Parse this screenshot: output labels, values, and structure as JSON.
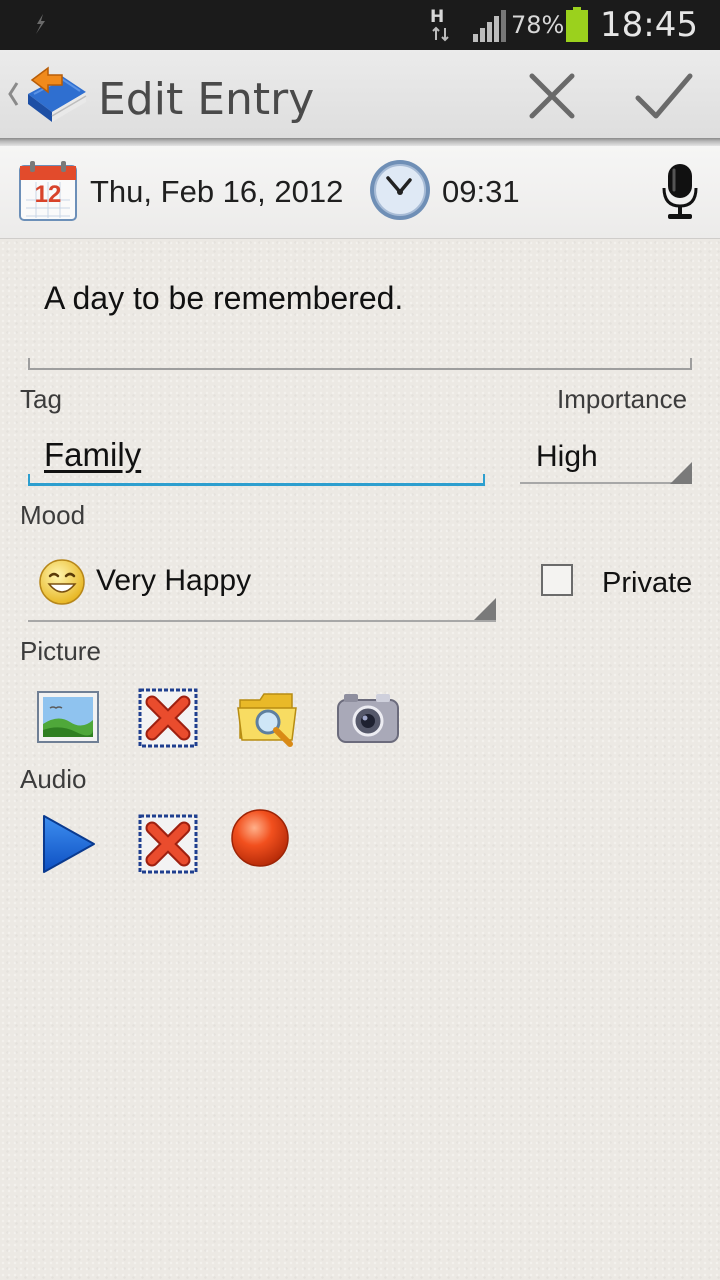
{
  "status_bar": {
    "network_type": "H",
    "battery_percent": "78%",
    "time": "18:45",
    "icons": [
      "usb-icon",
      "data-sync-icon",
      "signal-icon",
      "battery-icon"
    ],
    "battery_color": "#9bd11d"
  },
  "action_bar": {
    "title": "Edit Entry",
    "icons": [
      "up-caret-icon",
      "diary-book-icon",
      "close-icon",
      "checkmark-icon"
    ]
  },
  "date_row": {
    "date": "Thu, Feb 16, 2012",
    "time": "09:31",
    "calendar_day": "12",
    "icons": [
      "calendar-icon",
      "clock-icon",
      "microphone-icon"
    ]
  },
  "entry": {
    "text": "A day to be remembered."
  },
  "fields": {
    "tag_label": "Tag",
    "tag_value": "Family",
    "importance_label": "Importance",
    "importance_value": "High",
    "mood_label": "Mood",
    "mood_value": "Very Happy",
    "private_label": "Private",
    "private_checked": false
  },
  "picture": {
    "label": "Picture",
    "buttons": [
      "view-picture-icon",
      "delete-picture-icon",
      "browse-folder-icon",
      "camera-icon"
    ]
  },
  "audio": {
    "label": "Audio",
    "buttons": [
      "play-icon",
      "delete-audio-icon",
      "record-icon"
    ]
  },
  "colors": {
    "accent": "#2e9fcf",
    "status_bar_bg": "#1b1b1b",
    "action_bar_bg": "#e6e6e6"
  }
}
